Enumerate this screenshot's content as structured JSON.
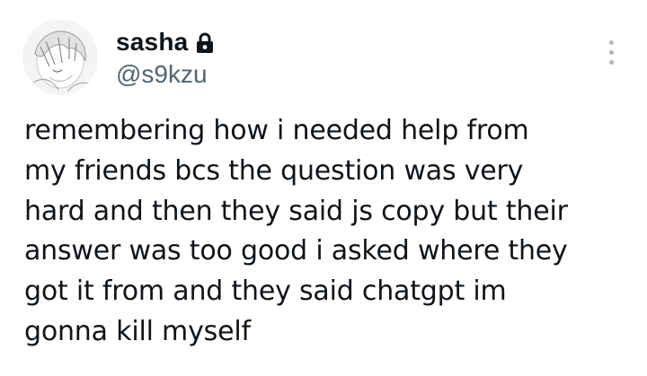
{
  "profile": {
    "display_name": "sasha",
    "handle": "@s9kzu",
    "avatar_icon": "avatar-image",
    "lock_icon": "lock-icon"
  },
  "tweet": {
    "text": "remembering how i needed help from\nmy friends bcs the question was very\nhard and then they said js copy but their\nanswer was too good i asked where they\ngot it from and they said chatgpt im\ngonna kill myself"
  },
  "menu": {
    "icon": "more-vertical-icon"
  },
  "colors": {
    "text": "#0f1419",
    "secondary": "#536471",
    "menu_dots": "#b0b8bf",
    "background": "#ffffff"
  }
}
